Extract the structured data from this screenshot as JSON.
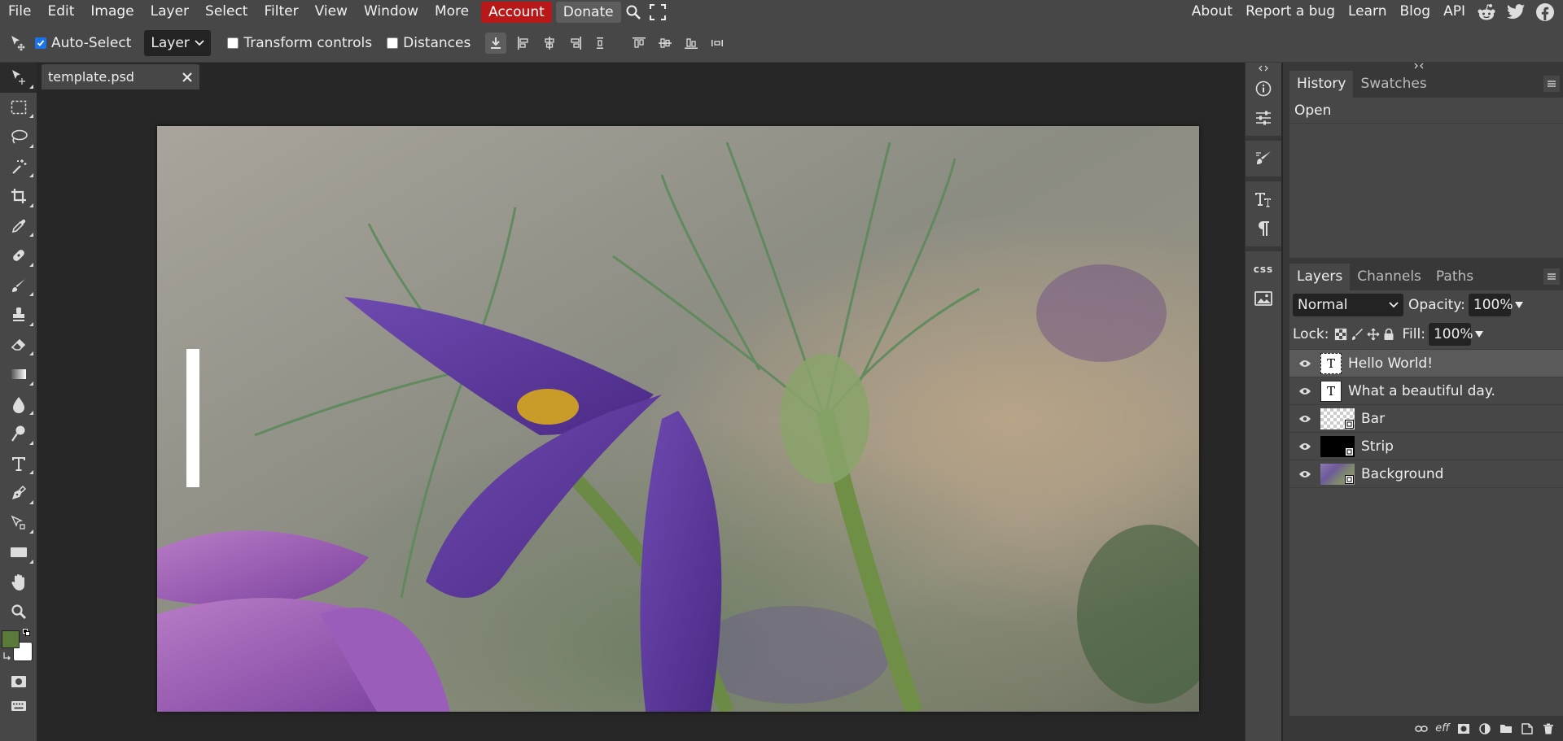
{
  "menubar": {
    "items": [
      "File",
      "Edit",
      "Image",
      "Layer",
      "Select",
      "Filter",
      "View",
      "Window",
      "More"
    ],
    "account_label": "Account",
    "donate_label": "Donate",
    "right_items": [
      "About",
      "Report a bug",
      "Learn",
      "Blog",
      "API"
    ],
    "icons": [
      "search-icon",
      "fullscreen-icon",
      "reddit-icon",
      "twitter-icon",
      "facebook-icon"
    ]
  },
  "options": {
    "auto_select_label": "Auto-Select",
    "auto_select_checked": true,
    "target_select_value": "Layer",
    "transform_controls_label": "Transform controls",
    "transform_controls_checked": false,
    "distances_label": "Distances",
    "distances_checked": false
  },
  "document": {
    "tab_name": "template.psd"
  },
  "colors": {
    "foreground": "#5b7a3a",
    "background": "#ffffff",
    "accent_account": "#b81818"
  },
  "iconstrip": {
    "css_label": "css"
  },
  "history": {
    "tabs": [
      "History",
      "Swatches"
    ],
    "entries": [
      "Open"
    ]
  },
  "layers": {
    "tabs": [
      "Layers",
      "Channels",
      "Paths"
    ],
    "blend_mode": "Normal",
    "opacity_label": "Opacity:",
    "opacity_value": "100%",
    "lock_label": "Lock:",
    "fill_label": "Fill:",
    "fill_value": "100%",
    "items": [
      {
        "name": "Hello World!",
        "kind": "text",
        "selected": true
      },
      {
        "name": "What a beautiful day.",
        "kind": "text",
        "selected": false
      },
      {
        "name": "Bar",
        "kind": "smart",
        "selected": false
      },
      {
        "name": "Strip",
        "kind": "smart",
        "selected": false
      },
      {
        "name": "Background",
        "kind": "smart",
        "selected": false
      }
    ],
    "footer_eff_label": "eff"
  }
}
